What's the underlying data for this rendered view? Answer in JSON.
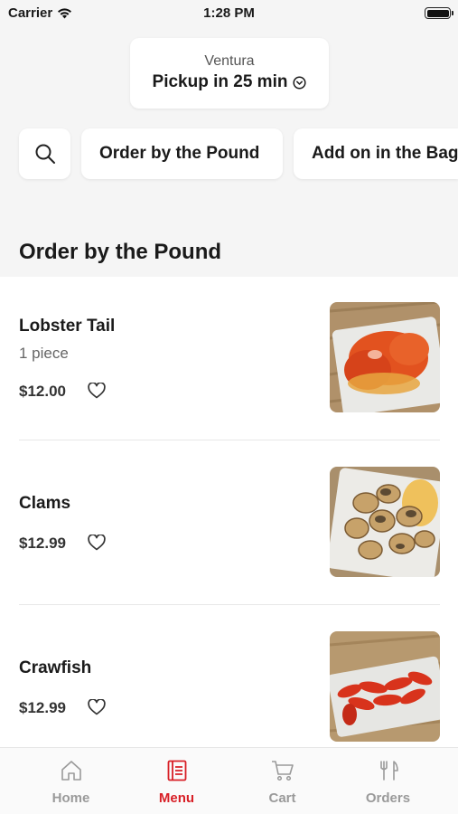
{
  "status_bar": {
    "carrier": "Carrier",
    "time": "1:28 PM"
  },
  "location": {
    "name": "Ventura",
    "pickup": "Pickup in 25 min"
  },
  "categories": [
    "Order by the Pound",
    "Add on in the Bag"
  ],
  "section_title": "Order by the Pound",
  "items": [
    {
      "name": "Lobster Tail",
      "subtitle": "1 piece",
      "price": "$12.00",
      "image": "lobster-tail-photo"
    },
    {
      "name": "Clams",
      "price": "$12.99",
      "image": "clams-photo"
    },
    {
      "name": "Crawfish",
      "price": "$12.99",
      "image": "crawfish-photo"
    }
  ],
  "tabs": [
    {
      "label": "Home",
      "icon": "home-icon",
      "active": false
    },
    {
      "label": "Menu",
      "icon": "menu-icon",
      "active": true
    },
    {
      "label": "Cart",
      "icon": "cart-icon",
      "active": false
    },
    {
      "label": "Orders",
      "icon": "orders-icon",
      "active": false
    }
  ],
  "colors": {
    "accent": "#d81f26",
    "header_bg": "#f5f5f5",
    "inactive": "#9a9a9a"
  }
}
